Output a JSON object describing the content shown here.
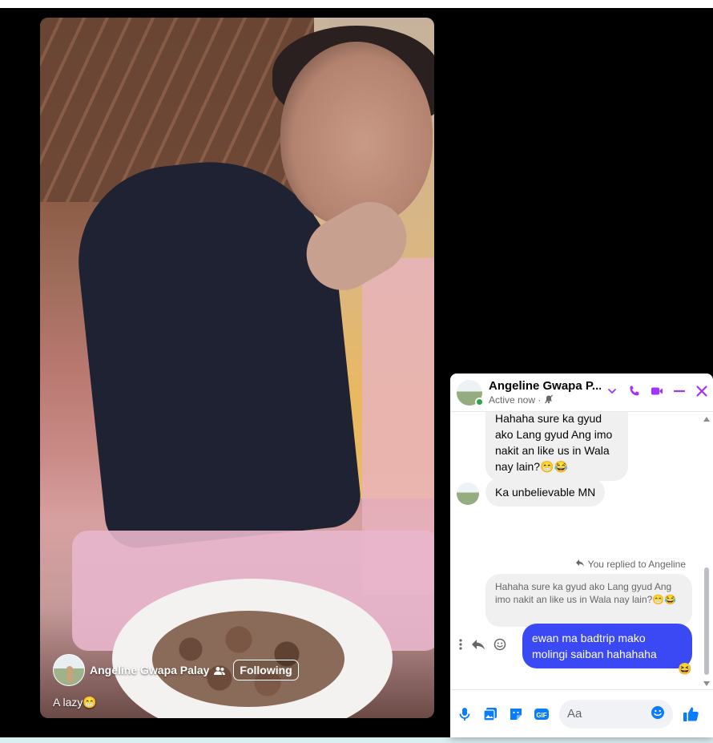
{
  "reel": {
    "author_name": "Angeline Gwapa Palay",
    "follow_label": "Following",
    "caption": "A lazy😁"
  },
  "chat": {
    "contact_name": "Angeline Gwapa P...",
    "status": "Active now ·",
    "messages": {
      "partial_incoming": "Hahaha sure ka gyud ako Lang gyud Ang imo nakit an like us in Wala nay lain?😁😂",
      "incoming_2": "Ka unbelievable MN",
      "reply_note": "You replied to Angeline",
      "quoted": "Hahaha sure ka gyud ako Lang gyud Ang imo nakit an like us in Wala nay lain?😁😂",
      "outgoing": "ewan ma badtrip mako molingi saiban hahahaha",
      "reaction": "😆"
    },
    "composer": {
      "placeholder": "Aa"
    }
  },
  "colors": {
    "messenger_purple": "#a033ff",
    "outgoing_bubble": "#3b49f5",
    "composer_blue": "#0a7cff",
    "online_green": "#31a24c"
  },
  "icons": [
    "friends-icon",
    "muted-icon",
    "chevron-down-icon",
    "phone-icon",
    "video-camera-icon",
    "minimize-icon",
    "close-icon",
    "reply-icon",
    "more-icon",
    "emoji-icon",
    "microphone-icon",
    "photo-icon",
    "sticker-icon",
    "gif-icon",
    "like-icon"
  ]
}
